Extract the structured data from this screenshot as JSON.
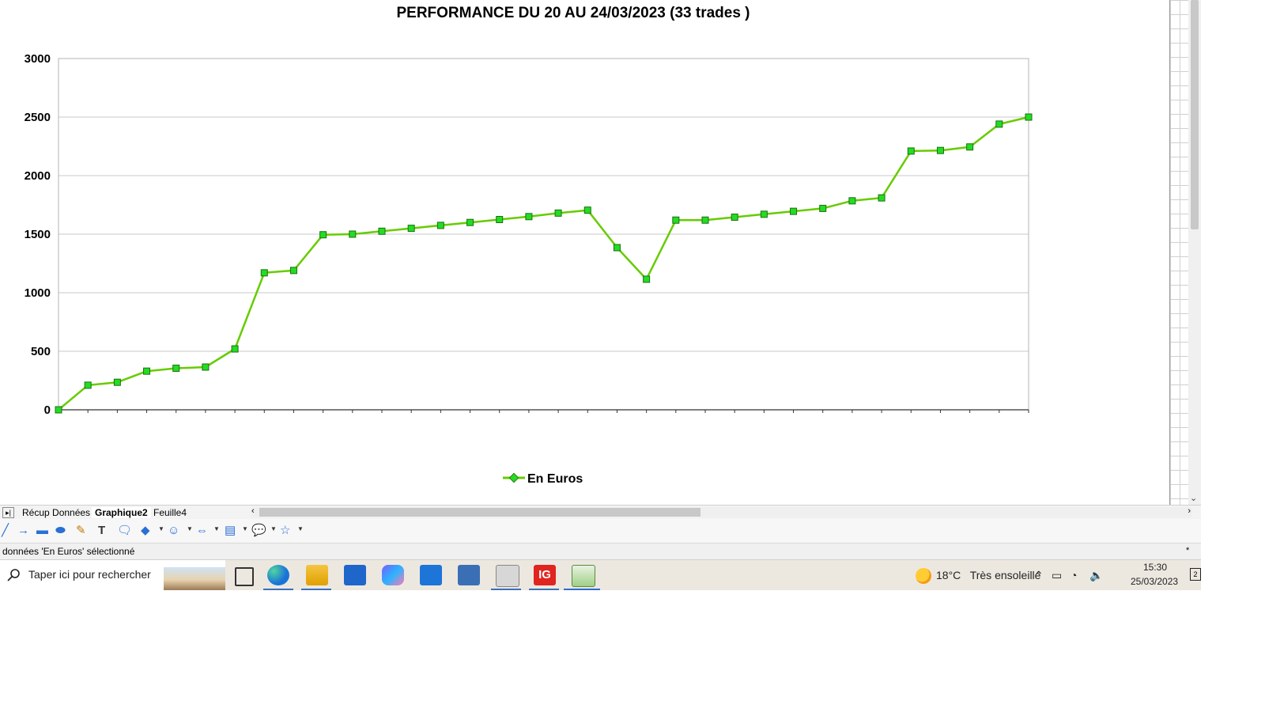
{
  "chart_data": {
    "type": "line",
    "title": "PERFORMANCE DU 20 AU 24/03/2023 (33 trades )",
    "ylim": [
      0,
      3000
    ],
    "yticks": [
      0,
      500,
      1000,
      1500,
      2000,
      2500,
      3000
    ],
    "grid": true,
    "legend_position": "bottom",
    "series": [
      {
        "name": "En Euros",
        "color": "#66cc00",
        "marker_color": "#22dd22",
        "values": [
          0,
          210,
          235,
          330,
          355,
          365,
          520,
          1170,
          1190,
          1495,
          1500,
          1525,
          1550,
          1575,
          1600,
          1625,
          1650,
          1680,
          1705,
          1385,
          1115,
          1620,
          1620,
          1645,
          1670,
          1695,
          1720,
          1785,
          1810,
          2210,
          2215,
          2245,
          2440,
          2500
        ]
      }
    ]
  },
  "sheet_tabs": {
    "tabs": [
      "Récup Données",
      "Graphique2",
      "Feuille4"
    ],
    "active": "Graphique2"
  },
  "drawing_toolbar": {
    "tools": [
      "line-icon",
      "arrow-icon",
      "rectangle-icon",
      "ellipse-icon",
      "freeform-icon",
      "text-icon",
      "callout-icon",
      "basic-shapes-icon",
      "smiley-icon",
      "block-arrows-icon",
      "flowchart-icon",
      "callouts-icon",
      "stars-icon"
    ]
  },
  "status_bar": {
    "text": "données 'En Euros' sélectionné",
    "modified_marker": "*"
  },
  "taskbar": {
    "search_placeholder": "Taper ici pour rechercher",
    "weather_temp": "18°C",
    "weather_desc": "Très ensoleillé",
    "clock_time": "15:30",
    "clock_date": "25/03/2023",
    "notification_count": "2",
    "apps": [
      "task-view-icon",
      "edge-icon",
      "file-explorer-icon",
      "store-icon",
      "copilot-icon",
      "mail-icon",
      "calculator-icon",
      "chart-app-icon",
      "ig-icon",
      "calc-spreadsheet-icon"
    ],
    "ig_label": "IG"
  }
}
